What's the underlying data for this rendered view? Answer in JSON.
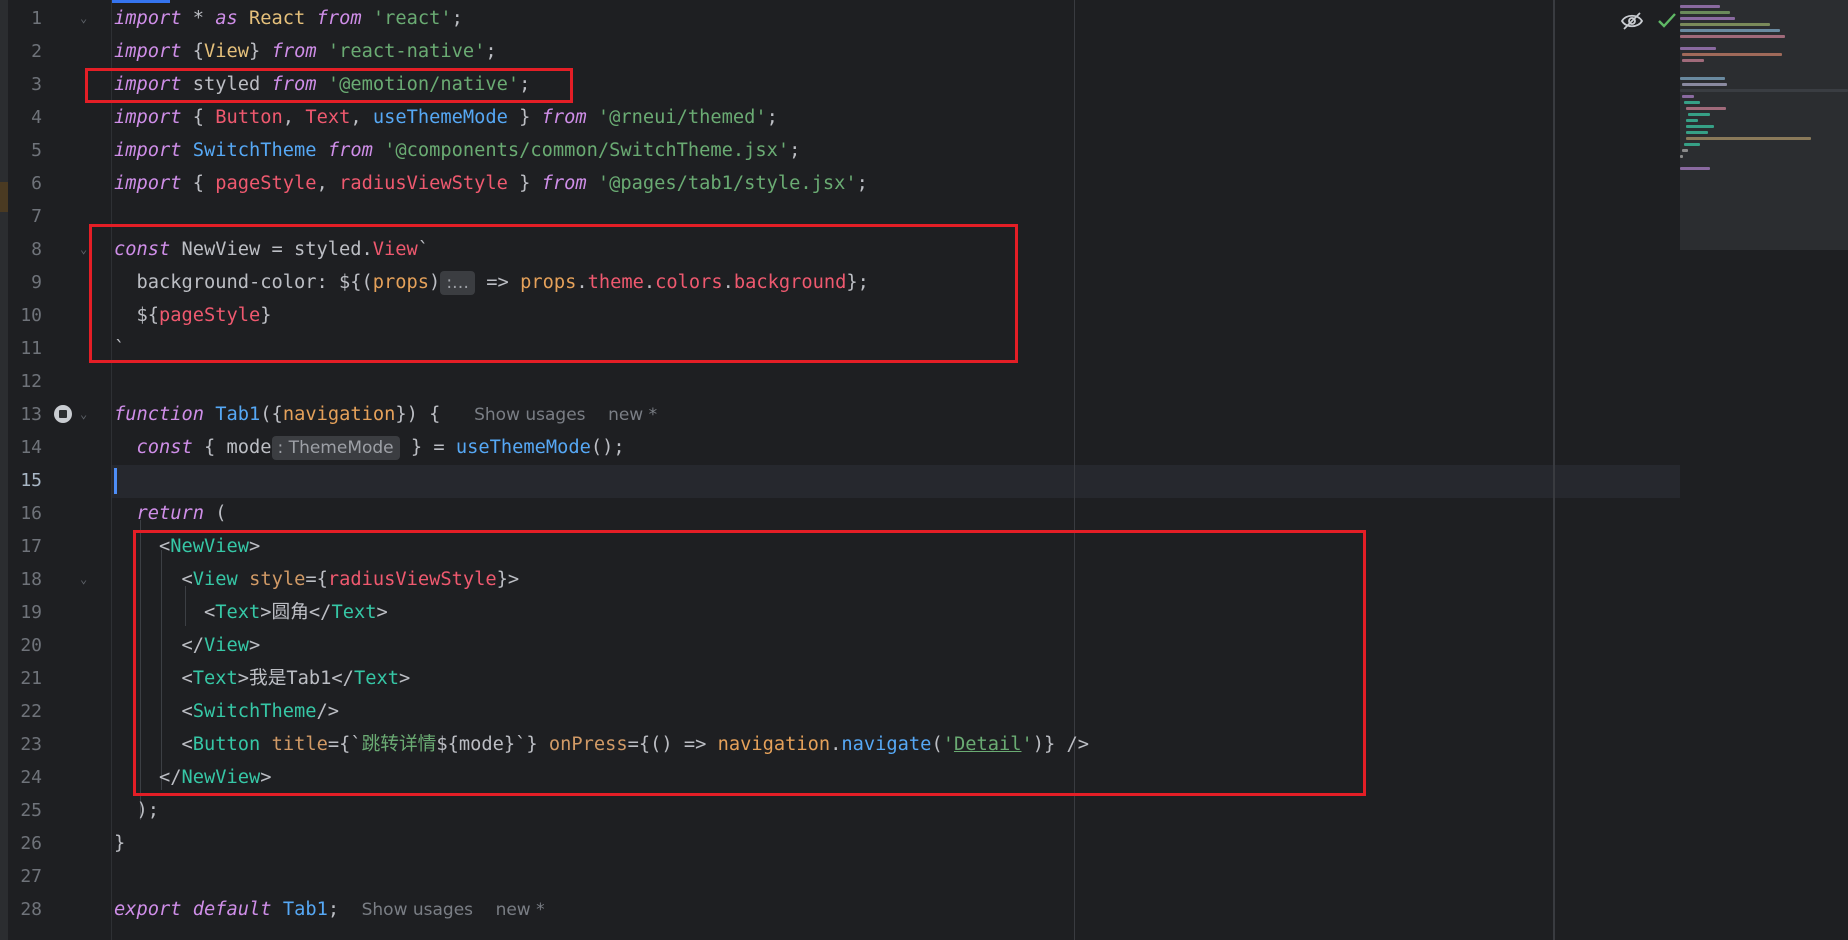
{
  "line_numbers": [
    "1",
    "2",
    "3",
    "4",
    "5",
    "6",
    "7",
    "8",
    "9",
    "10",
    "11",
    "12",
    "13",
    "14",
    "15",
    "16",
    "17",
    "18",
    "19",
    "20",
    "21",
    "22",
    "23",
    "24",
    "25",
    "26",
    "27",
    "28"
  ],
  "lines": {
    "l1": {
      "kw1": "import",
      "t1": " * ",
      "kw2": "as",
      "t2": " React ",
      "kw3": "from",
      "t3": " ",
      "s1": "'react'",
      "t4": ";"
    },
    "l2": {
      "kw1": "import",
      "t1": " {",
      "c1": "View",
      "t2": "} ",
      "kw2": "from",
      "t3": " ",
      "s1": "'react-native'",
      "t4": ";"
    },
    "l3": {
      "kw1": "import",
      "t1": " styled ",
      "kw2": "from",
      "t2": " ",
      "s1": "'@emotion/native'",
      "t3": ";"
    },
    "l4": {
      "kw1": "import",
      "t1": " { ",
      "i1": "Button",
      "t2": ", ",
      "i2": "Text",
      "t3": ", ",
      "f1": "useThemeMode",
      "t4": " } ",
      "kw2": "from",
      "t5": " ",
      "s1": "'@rneui/themed'",
      "t6": ";"
    },
    "l5": {
      "kw1": "import",
      "t1": " ",
      "c1": "SwitchTheme",
      "t2": " ",
      "kw2": "from",
      "t3": " ",
      "s1": "'@components/common/SwitchTheme.jsx'",
      "t4": ";"
    },
    "l6": {
      "kw1": "import",
      "t1": " { ",
      "i1": "pageStyle",
      "t2": ", ",
      "i2": "radiusViewStyle",
      "t3": " } ",
      "kw2": "from",
      "t4": " ",
      "s1": "'@pages/tab1/style.jsx'",
      "t5": ";"
    },
    "l8": {
      "kw1": "const",
      "t1": " NewView = styled.",
      "i1": "View",
      "t2": "`"
    },
    "l9": {
      "t1": "  background-color: ${(",
      "p1": "props",
      "t2": ")",
      "hint": ":…",
      "t3": " => ",
      "p2": "props",
      "t4": ".",
      "i1": "theme",
      "t5": ".",
      "i2": "colors",
      "t6": ".",
      "i3": "background",
      "t7": "};"
    },
    "l10": {
      "t1": "  ${",
      "i1": "pageStyle",
      "t2": "}"
    },
    "l11": {
      "t1": "`"
    },
    "l13": {
      "kw1": "function",
      "t1": " ",
      "f1": "Tab1",
      "t2": "({",
      "p1": "navigation",
      "t3": "}) {",
      "m1": "Show usages",
      "m2": "new *"
    },
    "l14": {
      "kw1": "const",
      "t1": " { mode",
      "hint": ": ThemeMode",
      "t2": " } = ",
      "f1": "useThemeMode",
      "t3": "();"
    },
    "l16": {
      "kw1": "return",
      "t1": " ("
    },
    "l17": {
      "t1": "<",
      "g1": "NewView",
      "t2": ">"
    },
    "l18": {
      "t1": "<",
      "g1": "View",
      "t2": " ",
      "a1": "style",
      "t3": "={",
      "i1": "radiusViewStyle",
      "t4": "}>"
    },
    "l19": {
      "t1": "<",
      "g1": "Text",
      "t2": ">圆角</",
      "g2": "Text",
      "t3": ">"
    },
    "l20": {
      "t1": "</",
      "g1": "View",
      "t2": ">"
    },
    "l21": {
      "t1": "<",
      "g1": "Text",
      "t2": ">我是Tab1</",
      "g2": "Text",
      "t3": ">"
    },
    "l22": {
      "t1": "<",
      "g1": "SwitchTheme",
      "t2": "/>"
    },
    "l23": {
      "t1": "<",
      "g1": "Button",
      "t2": " ",
      "a1": "title",
      "t3": "={`",
      "s1": "跳转详情",
      "t4": "${mode}`} ",
      "a2": "onPress",
      "t5": "={() => ",
      "p1": "navigation",
      "t6": ".",
      "f1": "navigate",
      "t7": "(",
      "s2": "'",
      "s3": "Detail",
      "s4": "'",
      "t8": ")} />"
    },
    "l24": {
      "t1": "</",
      "g1": "NewView",
      "t2": ">"
    },
    "l25": {
      "t1": ");"
    },
    "l26": {
      "t1": "}"
    },
    "l28": {
      "kw1": "export",
      "t1": " ",
      "kw2": "default",
      "t2": " ",
      "f1": "Tab1",
      "t3": ";",
      "m1": "Show usages",
      "m2": "new *"
    }
  },
  "icons": {
    "reader_mode": "eye-slash-icon",
    "inspection_ok": "checkmark-icon",
    "gutter_run": "run-gutter-icon"
  },
  "colors": {
    "highlight_box": "#e41e26",
    "caret": "#4e8ef7",
    "background": "#1e1f22"
  }
}
